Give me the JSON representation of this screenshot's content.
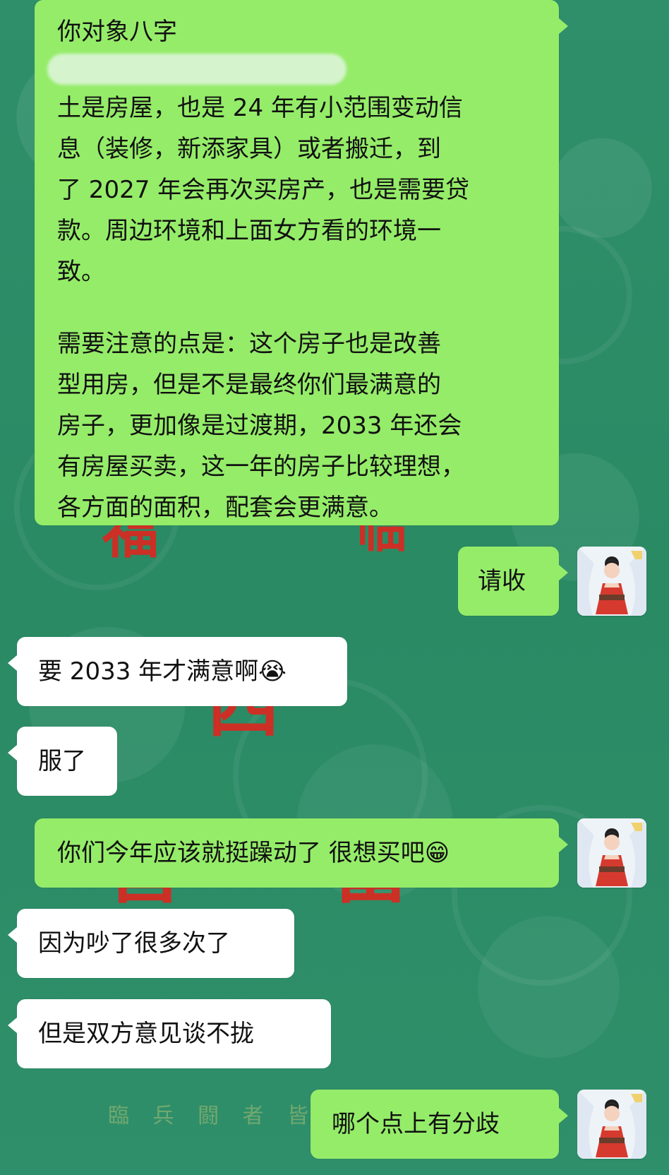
{
  "messages": [
    {
      "id": "m0",
      "direction": "outgoing",
      "lines": [
        "你对象八字",
        "土是房屋，也是 24 年有小范围变动信",
        "息（装修，新添家具）或者搬迁，到",
        "了 2027 年会再次买房产，也是需要贷",
        "款。周边环境和上面女方看的环境一",
        "致。",
        "需要注意的点是：这个房子也是改善",
        "型用房，但是不是最终你们最满意的",
        "房子，更加像是过渡期，2033 年还会",
        "有房屋买卖，这一年的房子比较理想，",
        "各方面的面积，配套会更满意。"
      ]
    },
    {
      "id": "m1",
      "direction": "outgoing",
      "text": "请收"
    },
    {
      "id": "m2",
      "direction": "incoming",
      "text": "要 2033 年才满意啊😭"
    },
    {
      "id": "m3",
      "direction": "incoming",
      "text": "服了"
    },
    {
      "id": "m4",
      "direction": "outgoing",
      "text": "你们今年应该就挺躁动了 很想买吧😁"
    },
    {
      "id": "m5",
      "direction": "incoming",
      "text": "因为吵了很多次了"
    },
    {
      "id": "m6",
      "direction": "incoming",
      "text": "但是双方意见谈不拢"
    },
    {
      "id": "m7",
      "direction": "outgoing",
      "text": "哪个点上有分歧"
    }
  ],
  "background": {
    "red_characters": [
      "福",
      "临",
      "四",
      "喜",
      "富"
    ],
    "bottom_phrase": "臨 兵 闘 者 皆"
  },
  "colors": {
    "background": "#2f8f6a",
    "outgoing_bubble": "#95ec69",
    "incoming_bubble": "#ffffff",
    "decor_red": "#d52b22"
  }
}
